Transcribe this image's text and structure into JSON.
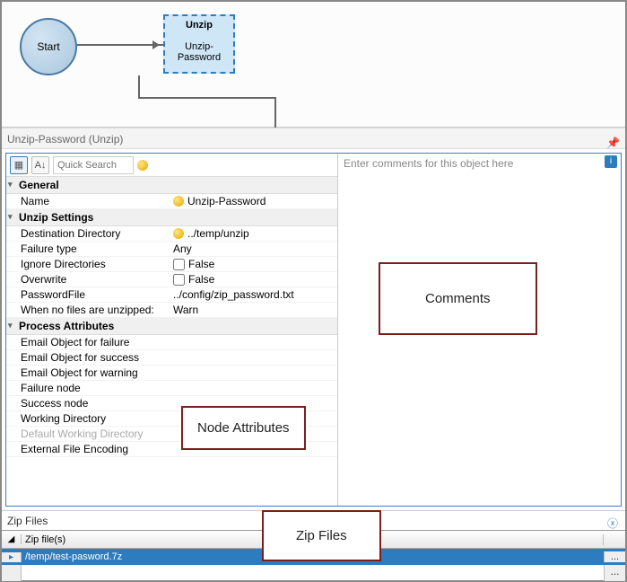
{
  "canvas": {
    "start_label": "Start",
    "node_title": "Unzip",
    "node_sub": "Unzip-Password"
  },
  "panel_title": "Unzip-Password (Unzip)",
  "toolbar": {
    "search_placeholder": "Quick Search"
  },
  "sections": {
    "general": "General",
    "unzip": "Unzip Settings",
    "process": "Process Attributes"
  },
  "props": {
    "name_label": "Name",
    "name_value": "Unzip-Password",
    "destdir_label": "Destination Directory",
    "destdir_value": "../temp/unzip",
    "failtype_label": "Failure type",
    "failtype_value": "Any",
    "ignoredirs_label": "Ignore Directories",
    "ignoredirs_value": "False",
    "overwrite_label": "Overwrite",
    "overwrite_value": "False",
    "pwfile_label": "PasswordFile",
    "pwfile_value": "../config/zip_password.txt",
    "nofiles_label": "When no files are unzipped:",
    "nofiles_value": "Warn",
    "emailfail_label": "Email Object for failure",
    "emailsucc_label": "Email Object for success",
    "emailwarn_label": "Email Object for warning",
    "failnode_label": "Failure node",
    "succnode_label": "Success node",
    "workdir_label": "Working Directory",
    "defworkdir_label": "Default Working Directory",
    "extenc_label": "External File Encoding"
  },
  "comments": {
    "placeholder": "Enter comments for this object here"
  },
  "zip": {
    "title": "Zip Files",
    "col": "Zip file(s)",
    "row0": "/temp/test-pasword.7z",
    "btn": "..."
  },
  "annotations": {
    "node_attrs": "Node Attributes",
    "comments": "Comments",
    "zipfiles": "Zip Files"
  }
}
